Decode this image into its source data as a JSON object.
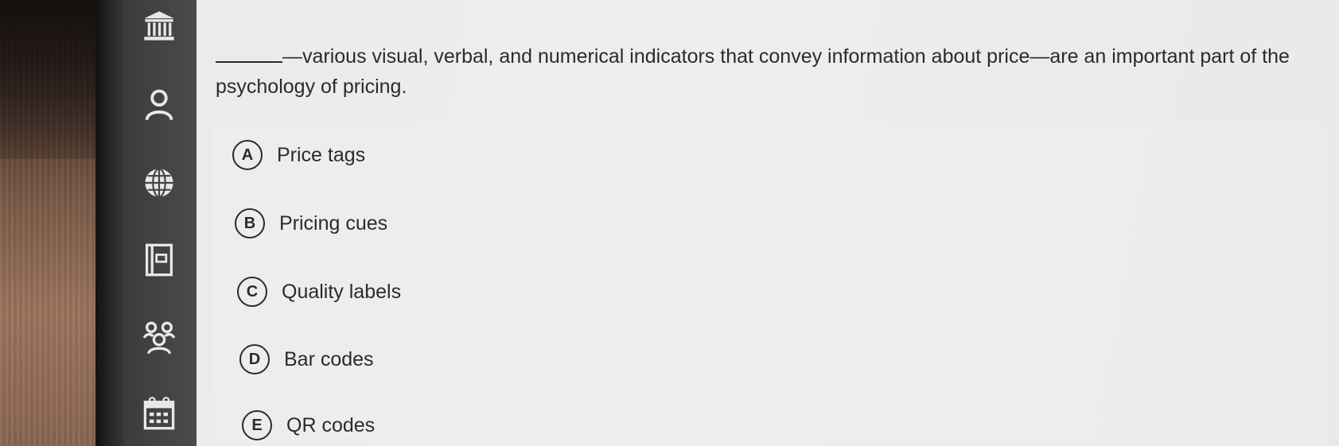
{
  "question": {
    "text": "—various visual, verbal, and numerical indicators that convey information about price—are an important part of the psychology of pricing."
  },
  "options": [
    {
      "letter": "A",
      "label": "Price tags"
    },
    {
      "letter": "B",
      "label": "Pricing cues"
    },
    {
      "letter": "C",
      "label": "Quality labels"
    },
    {
      "letter": "D",
      "label": "Bar codes"
    },
    {
      "letter": "E",
      "label": "QR codes"
    }
  ],
  "sidebar": {
    "icons": [
      "institution-icon",
      "user-icon",
      "globe-icon",
      "book-icon",
      "group-icon",
      "calendar-icon"
    ]
  },
  "colors": {
    "panel": "#eceeef",
    "sidebar": "#434446",
    "text": "#2a2b2d"
  }
}
